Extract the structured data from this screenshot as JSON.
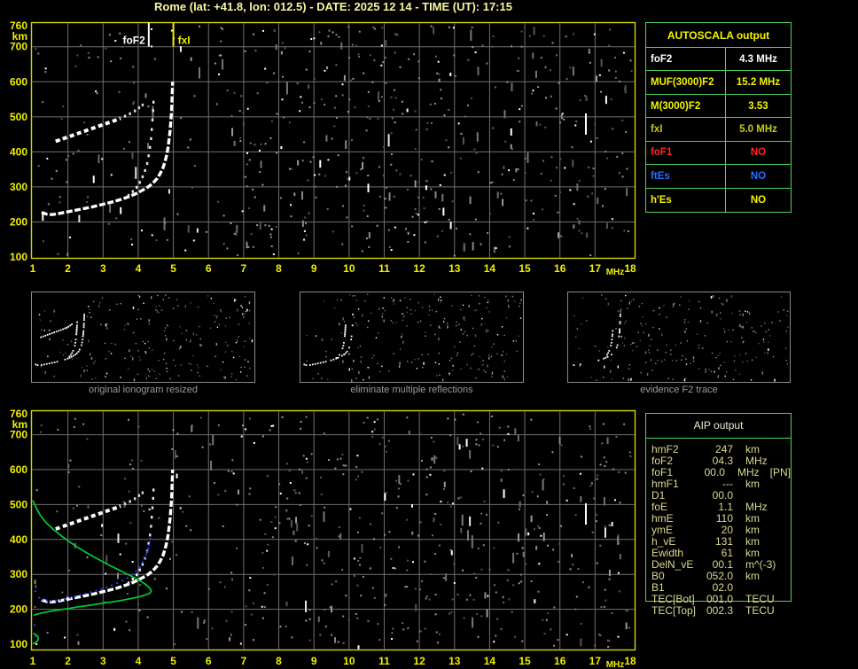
{
  "title": "Rome (lat: +41.8, lon: 012.5) - DATE: 2025 12 14 - TIME (UT): 17:15",
  "colors": {
    "axis_yellow": "#f0f000",
    "border_yellow": "#d6d600",
    "table_green": "#4cd45c",
    "grid_gray": "#6f6f6f",
    "trace_white": "#ffffff",
    "profile_green": "#00cc33",
    "fit_blue": "#2b3cff",
    "red": "#ff2222",
    "blue": "#2b6bff",
    "pale_yellow": "#d9d98e",
    "caption_gray": "#9c9c9c"
  },
  "autoscala": {
    "header": "AUTOSCALA output",
    "rows": [
      {
        "label": "foF2",
        "value": "4.3 MHz",
        "color": "#ffffff"
      },
      {
        "label": "MUF(3000)F2",
        "value": "15.2 MHz",
        "color": "#f4f400"
      },
      {
        "label": "M(3000)F2",
        "value": "3.53",
        "color": "#f4f400"
      },
      {
        "label": "fxI",
        "value": "5.0 MHz",
        "color": "#c9c914"
      },
      {
        "label": "foF1",
        "value": "NO",
        "color": "#ff2222"
      },
      {
        "label": "ftEs",
        "value": "NO",
        "color": "#2b6bff"
      },
      {
        "label": "h'Es",
        "value": "NO",
        "color": "#f4f400"
      }
    ]
  },
  "aip": {
    "header": "AIP output",
    "rows": [
      {
        "label": "hmF2",
        "value": "247",
        "unit": "km",
        "note": ""
      },
      {
        "label": "foF2",
        "value": "04.3",
        "unit": "MHz",
        "note": ""
      },
      {
        "label": "foF1",
        "value": "00.0",
        "unit": "MHz",
        "note": "[PN]"
      },
      {
        "label": "hmF1",
        "value": "---",
        "unit": "km",
        "note": ""
      },
      {
        "label": "D1",
        "value": "00.0",
        "unit": "",
        "note": ""
      },
      {
        "label": "foE",
        "value": "1.1",
        "unit": "MHz",
        "note": ""
      },
      {
        "label": "hmE",
        "value": "110",
        "unit": "km",
        "note": ""
      },
      {
        "label": "ymE",
        "value": "20",
        "unit": "km",
        "note": ""
      },
      {
        "label": "h_vE",
        "value": "131",
        "unit": "km",
        "note": ""
      },
      {
        "label": "Ewidth",
        "value": "61",
        "unit": "km",
        "note": ""
      },
      {
        "label": "DelN_vE",
        "value": "00.1",
        "unit": "m^(-3)",
        "note": ""
      },
      {
        "label": "B0",
        "value": "052.0",
        "unit": "km",
        "note": ""
      },
      {
        "label": "B1",
        "value": "02.0",
        "unit": "",
        "note": ""
      },
      {
        "label": "TEC[Bot]",
        "value": "001.0",
        "unit": "TECU",
        "note": ""
      },
      {
        "label": "TEC[Top]",
        "value": "002.3",
        "unit": "TECU",
        "note": ""
      }
    ]
  },
  "thumbnails": [
    {
      "caption": "original ionogram resized"
    },
    {
      "caption": "eliminate multiple reflections"
    },
    {
      "caption": "evidence F2 trace"
    }
  ],
  "chart_data": [
    {
      "id": "main_ionogram",
      "type": "scatter",
      "title": "",
      "xlabel": "MHz",
      "ylabel": "km",
      "xlim": [
        1,
        18
      ],
      "ylim": [
        100,
        760
      ],
      "x_ticks": [
        1,
        2,
        3,
        4,
        5,
        6,
        7,
        8,
        9,
        10,
        11,
        12,
        13,
        14,
        15,
        16,
        17,
        18
      ],
      "y_ticks": [
        760,
        700,
        600,
        500,
        400,
        300,
        200,
        100
      ],
      "grid": true,
      "markers": [
        {
          "label": "foF2",
          "x": 4.3,
          "color": "#ffffff"
        },
        {
          "label": "fxI",
          "x": 5.0,
          "color": "#f0f000"
        }
      ],
      "series": [
        {
          "name": "F-trace (x-mode to fxI)",
          "style": "trace",
          "color": "#ffffff",
          "points": [
            [
              1.25,
              227
            ],
            [
              1.4,
              222
            ],
            [
              1.55,
              221
            ],
            [
              1.7,
              223
            ],
            [
              1.9,
              227
            ],
            [
              2.1,
              231
            ],
            [
              2.3,
              235
            ],
            [
              2.5,
              239
            ],
            [
              2.7,
              243
            ],
            [
              2.9,
              248
            ],
            [
              3.1,
              253
            ],
            [
              3.3,
              258
            ],
            [
              3.5,
              264
            ],
            [
              3.7,
              271
            ],
            [
              3.85,
              277
            ],
            [
              4.0,
              284
            ],
            [
              4.15,
              292
            ],
            [
              4.3,
              301
            ],
            [
              4.42,
              311
            ],
            [
              4.53,
              323
            ],
            [
              4.62,
              337
            ],
            [
              4.7,
              353
            ],
            [
              4.76,
              371
            ],
            [
              4.81,
              391
            ],
            [
              4.85,
              413
            ],
            [
              4.88,
              437
            ],
            [
              4.91,
              463
            ],
            [
              4.93,
              490
            ],
            [
              4.95,
              518
            ],
            [
              4.96,
              545
            ],
            [
              4.97,
              572
            ],
            [
              4.98,
              600
            ]
          ]
        },
        {
          "name": "o-mode asymptote at foF2",
          "style": "dots",
          "color": "#e8e8e8",
          "points": [
            [
              3.72,
              276
            ],
            [
              3.84,
              287
            ],
            [
              3.95,
              299
            ],
            [
              4.04,
              313
            ],
            [
              4.12,
              329
            ],
            [
              4.19,
              347
            ],
            [
              4.25,
              367
            ],
            [
              4.29,
              389
            ],
            [
              4.33,
              413
            ],
            [
              4.36,
              438
            ],
            [
              4.38,
              464
            ],
            [
              4.4,
              491
            ],
            [
              4.42,
              518
            ],
            [
              4.43,
              542
            ]
          ]
        },
        {
          "name": "second-hop reflection",
          "style": "hop",
          "color": "#ffffff",
          "points": [
            [
              1.65,
              430
            ],
            [
              1.82,
              436
            ],
            [
              1.99,
              442
            ],
            [
              2.16,
              448
            ],
            [
              2.33,
              454
            ],
            [
              2.5,
              460
            ],
            [
              2.67,
              466
            ],
            [
              2.84,
              472
            ],
            [
              3.01,
              478
            ],
            [
              3.18,
              484
            ],
            [
              3.35,
              490
            ],
            [
              3.5,
              496
            ]
          ]
        },
        {
          "name": "second-hop sparse tail",
          "style": "dots",
          "color": "#d8d8d8",
          "points": [
            [
              3.62,
              502
            ],
            [
              3.76,
              509
            ],
            [
              3.9,
              517
            ],
            [
              4.02,
              526
            ],
            [
              4.12,
              534
            ]
          ]
        }
      ]
    },
    {
      "id": "inverted_ionogram_with_profile",
      "type": "scatter",
      "title": "",
      "xlabel": "MHz",
      "ylabel": "km",
      "xlim": [
        1,
        18
      ],
      "ylim": [
        100,
        760
      ],
      "x_ticks": [
        1,
        2,
        3,
        4,
        5,
        6,
        7,
        8,
        9,
        10,
        11,
        12,
        13,
        14,
        15,
        16,
        17,
        18
      ],
      "y_ticks": [
        760,
        700,
        600,
        500,
        400,
        300,
        200,
        100
      ],
      "grid": true,
      "markers": [],
      "series": [
        {
          "name": "F-trace (x-mode to fxI)",
          "style": "trace",
          "color": "#ffffff",
          "points": [
            [
              1.25,
              227
            ],
            [
              1.4,
              222
            ],
            [
              1.55,
              221
            ],
            [
              1.7,
              223
            ],
            [
              1.9,
              227
            ],
            [
              2.1,
              231
            ],
            [
              2.3,
              235
            ],
            [
              2.5,
              239
            ],
            [
              2.7,
              243
            ],
            [
              2.9,
              248
            ],
            [
              3.1,
              253
            ],
            [
              3.3,
              258
            ],
            [
              3.5,
              264
            ],
            [
              3.7,
              271
            ],
            [
              3.85,
              277
            ],
            [
              4.0,
              284
            ],
            [
              4.15,
              292
            ],
            [
              4.3,
              301
            ],
            [
              4.42,
              311
            ],
            [
              4.53,
              323
            ],
            [
              4.62,
              337
            ],
            [
              4.7,
              353
            ],
            [
              4.76,
              371
            ],
            [
              4.81,
              391
            ],
            [
              4.85,
              413
            ],
            [
              4.88,
              437
            ],
            [
              4.91,
              463
            ],
            [
              4.93,
              490
            ],
            [
              4.95,
              518
            ],
            [
              4.96,
              545
            ],
            [
              4.97,
              572
            ],
            [
              4.98,
              600
            ]
          ]
        },
        {
          "name": "o-mode asymptote at foF2",
          "style": "dots",
          "color": "#e8e8e8",
          "points": [
            [
              3.72,
              276
            ],
            [
              3.84,
              287
            ],
            [
              3.95,
              299
            ],
            [
              4.04,
              313
            ],
            [
              4.12,
              329
            ],
            [
              4.19,
              347
            ],
            [
              4.25,
              367
            ],
            [
              4.29,
              389
            ],
            [
              4.33,
              413
            ],
            [
              4.36,
              438
            ],
            [
              4.38,
              464
            ],
            [
              4.4,
              491
            ],
            [
              4.42,
              518
            ],
            [
              4.43,
              542
            ]
          ]
        },
        {
          "name": "second-hop reflection",
          "style": "hop",
          "color": "#ffffff",
          "points": [
            [
              1.65,
              430
            ],
            [
              1.82,
              436
            ],
            [
              1.99,
              442
            ],
            [
              2.16,
              448
            ],
            [
              2.33,
              454
            ],
            [
              2.5,
              460
            ],
            [
              2.67,
              466
            ],
            [
              2.84,
              472
            ],
            [
              3.01,
              478
            ],
            [
              3.18,
              484
            ],
            [
              3.35,
              490
            ],
            [
              3.5,
              496
            ]
          ]
        },
        {
          "name": "second-hop sparse tail",
          "style": "dots",
          "color": "#d8d8d8",
          "points": [
            [
              3.62,
              502
            ],
            [
              3.76,
              509
            ],
            [
              3.9,
              517
            ],
            [
              4.02,
              526
            ],
            [
              4.12,
              534
            ]
          ]
        },
        {
          "name": "electron density profile F-layer",
          "style": "profile",
          "color": "#00cc33",
          "points": [
            [
              1.0,
              512
            ],
            [
              1.1,
              490
            ],
            [
              1.22,
              468
            ],
            [
              1.38,
              448
            ],
            [
              1.58,
              429
            ],
            [
              1.8,
              411
            ],
            [
              2.02,
              395
            ],
            [
              2.25,
              379
            ],
            [
              2.48,
              365
            ],
            [
              2.72,
              351
            ],
            [
              2.96,
              338
            ],
            [
              3.2,
              325
            ],
            [
              3.44,
              313
            ],
            [
              3.66,
              302
            ],
            [
              3.88,
              291
            ],
            [
              4.06,
              281
            ],
            [
              4.2,
              272
            ],
            [
              4.3,
              263
            ],
            [
              4.36,
              256
            ],
            [
              4.37,
              251
            ],
            [
              4.33,
              246
            ],
            [
              4.24,
              242
            ],
            [
              4.1,
              238
            ],
            [
              3.92,
              233
            ],
            [
              3.7,
              229
            ],
            [
              3.45,
              224
            ],
            [
              3.18,
              220
            ],
            [
              2.9,
              216
            ],
            [
              2.6,
              211
            ],
            [
              2.3,
              207
            ],
            [
              2.0,
              202
            ],
            [
              1.72,
              198
            ],
            [
              1.45,
              193
            ],
            [
              1.2,
              188
            ],
            [
              1.02,
              183
            ]
          ]
        },
        {
          "name": "electron density profile E-layer",
          "style": "profile",
          "color": "#00cc33",
          "points": [
            [
              1.0,
              101
            ],
            [
              1.07,
              104
            ],
            [
              1.13,
              109
            ],
            [
              1.16,
              115
            ],
            [
              1.14,
              122
            ],
            [
              1.08,
              128
            ],
            [
              1.01,
              131
            ]
          ]
        },
        {
          "name": "fitted trace points",
          "style": "fit",
          "color": "#2b3cff",
          "points": [
            [
              1.18,
              233
            ],
            [
              1.28,
              228
            ],
            [
              1.4,
              225
            ],
            [
              1.52,
              224
            ],
            [
              1.65,
              225
            ],
            [
              1.78,
              227
            ],
            [
              1.92,
              230
            ],
            [
              2.06,
              233
            ],
            [
              2.2,
              237
            ],
            [
              2.35,
              241
            ],
            [
              2.5,
              245
            ],
            [
              2.65,
              249
            ],
            [
              2.8,
              253
            ],
            [
              2.95,
              258
            ],
            [
              3.1,
              263
            ],
            [
              3.25,
              269
            ],
            [
              3.4,
              275
            ],
            [
              3.55,
              282
            ],
            [
              3.69,
              290
            ],
            [
              3.82,
              299
            ],
            [
              3.94,
              309
            ],
            [
              4.04,
              321
            ],
            [
              4.13,
              334
            ],
            [
              4.2,
              349
            ],
            [
              4.26,
              366
            ],
            [
              4.31,
              384
            ],
            [
              4.34,
              402
            ]
          ]
        },
        {
          "name": "stray fitted points",
          "style": "stray",
          "color": "#2b3cff",
          "points": [
            [
              1.07,
              252
            ],
            [
              1.05,
              155
            ],
            [
              1.06,
              122
            ]
          ]
        }
      ]
    }
  ]
}
